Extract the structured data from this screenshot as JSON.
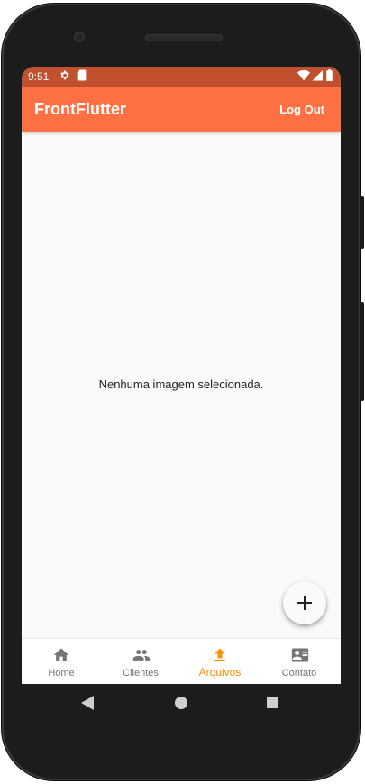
{
  "status_bar": {
    "time": "9:51",
    "left_icons": [
      "gear-icon",
      "sd-card-icon"
    ],
    "right_icons": [
      "wifi-icon",
      "cell-signal-icon",
      "battery-icon"
    ]
  },
  "app_bar": {
    "title": "FrontFlutter",
    "action_label": "Log Out"
  },
  "content": {
    "empty_message": "Nenhuma imagem selecionada."
  },
  "fab": {
    "icon": "plus-icon"
  },
  "bottom_nav": {
    "items": [
      {
        "label": "Home",
        "icon": "home-icon",
        "active": false
      },
      {
        "label": "Clientes",
        "icon": "people-icon",
        "active": false
      },
      {
        "label": "Arquivos",
        "icon": "upload-icon",
        "active": true
      },
      {
        "label": "Contato",
        "icon": "contact-card-icon",
        "active": false
      }
    ]
  },
  "system_nav": {
    "buttons": [
      "back-icon",
      "home-circle-icon",
      "recents-icon"
    ]
  },
  "colors": {
    "status_bar": "#c0502e",
    "app_bar": "#ff7043",
    "active_tab": "#ff8f00",
    "inactive_tab": "#757575"
  }
}
